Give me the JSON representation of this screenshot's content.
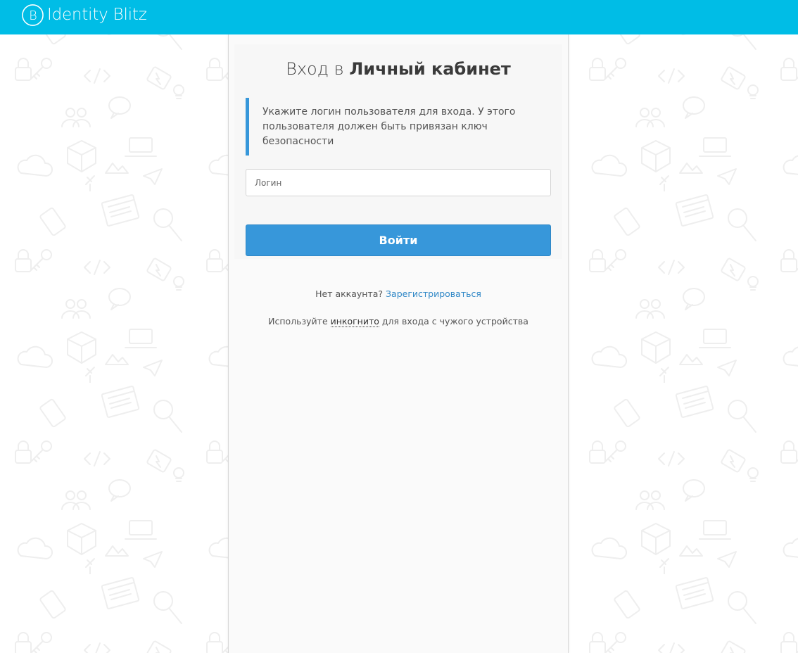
{
  "theme": {
    "brand_color": "#00bde6",
    "accent_color": "#3797da",
    "link_color": "#2f87c6"
  },
  "header": {
    "logo_letter": "B",
    "logo_text": "Identity Blitz"
  },
  "login": {
    "title_prefix": "Вход в",
    "title_strong": "Личный кабинет",
    "notice": "Укажите логин пользователя для входа. У этого пользователя должен быть привязан ключ безопасности",
    "input_placeholder": "Логин",
    "input_value": "",
    "submit_label": "Войти"
  },
  "footer": {
    "no_account_text": "Нет аккаунта?",
    "register_link": "Зарегистрироваться",
    "incognito_prefix": "Используйте",
    "incognito_link": "инкогнито",
    "incognito_suffix": "для входа с чужого устройства"
  }
}
